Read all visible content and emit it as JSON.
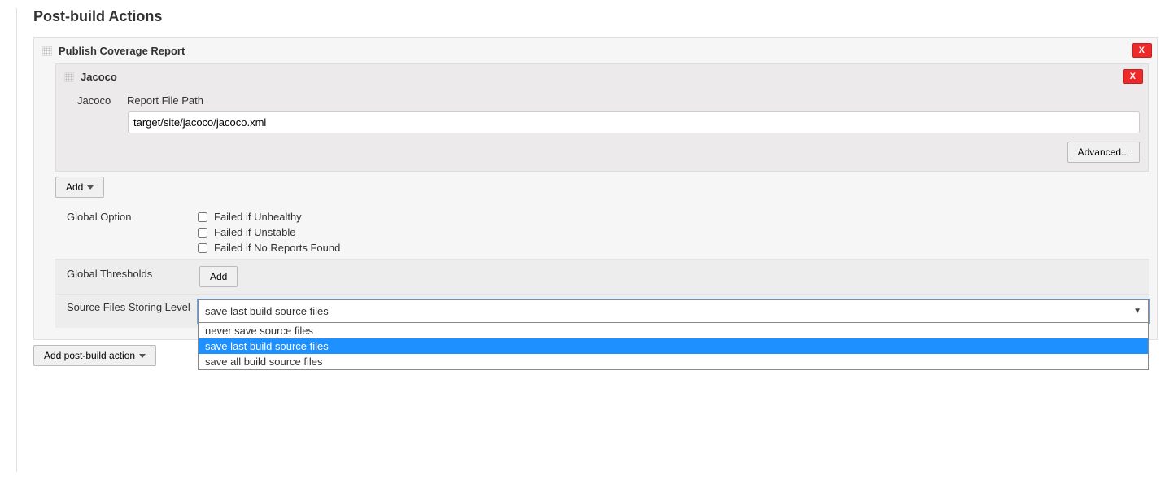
{
  "section_title": "Post-build Actions",
  "publisher": {
    "title": "Publish Coverage Report",
    "delete_label": "X",
    "adapter": {
      "title": "Jacoco",
      "delete_label": "X",
      "type_label": "Jacoco",
      "path_label": "Report File Path",
      "path_value": "target/site/jacoco/jacoco.xml",
      "advanced_label": "Advanced..."
    },
    "add_adapter_label": "Add",
    "global_option": {
      "label": "Global Option",
      "checkboxes": [
        {
          "label": "Failed if Unhealthy",
          "checked": false
        },
        {
          "label": "Failed if Unstable",
          "checked": false
        },
        {
          "label": "Failed if No Reports Found",
          "checked": false
        }
      ]
    },
    "global_thresholds": {
      "label": "Global Thresholds",
      "add_label": "Add"
    },
    "source_level": {
      "label": "Source Files Storing Level",
      "selected": "save last build source files",
      "options": [
        "never save source files",
        "save last build source files",
        "save all build source files"
      ]
    }
  },
  "add_post_build_label": "Add post-build action"
}
